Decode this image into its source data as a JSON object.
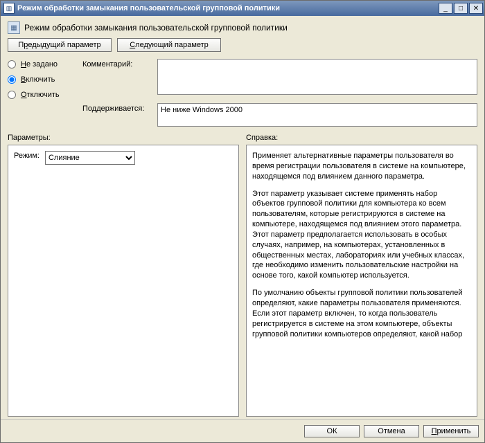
{
  "window": {
    "title": "Режим обработки замыкания пользовательской групповой политики"
  },
  "heading": "Режим обработки замыкания пользовательской групповой политики",
  "nav": {
    "prev_label_pre": "П",
    "prev_label_ul": "р",
    "prev_label_post": "едыдущий параметр",
    "next_label_ul": "С",
    "next_label_post": "ледующий параметр"
  },
  "state_radios": {
    "not_configured_ul": "Н",
    "not_configured_post": "е задано",
    "enabled_ul": "В",
    "enabled_post": "ключить",
    "disabled_ul": "О",
    "disabled_post": "тключить",
    "selected": "enabled"
  },
  "labels": {
    "comment": "Комментарий:",
    "supported": "Поддерживается:",
    "options": "Параметры:",
    "help": "Справка:",
    "mode": "Режим:"
  },
  "comment_value": "",
  "supported_text": "Не ниже Windows 2000",
  "mode_options": [
    "Слияние"
  ],
  "mode_selected": "Слияние",
  "help_paragraphs": [
    "Применяет альтернативные параметры пользователя во время регистрации пользователя в системе на компьютере, находящемся под влиянием данного параметра.",
    "Этот параметр указывает системе применять набор объектов групповой политики для компьютера ко всем пользователям, которые регистрируются в системе на компьютере, находящемся под влиянием этого параметра. Этот параметр предполагается использовать в особых случаях, например, на компьютерах, установленных в общественных местах, лабораториях или учебных классах, где необходимо изменить пользовательские настройки на основе того, какой компьютер используется.",
    "По умолчанию объекты групповой политики пользователей определяют, какие параметры пользователя применяются. Если этот параметр включен, то когда пользователь регистрируется в системе на этом компьютере, объекты групповой политики компьютеров определяют, какой набор"
  ],
  "footer": {
    "ok": "ОК",
    "cancel": "Отмена",
    "apply_ul": "П",
    "apply_post": "рименить"
  }
}
